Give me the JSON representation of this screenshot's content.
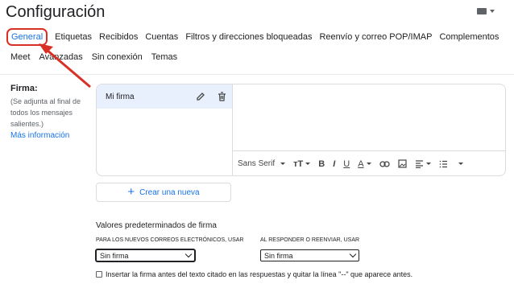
{
  "header": {
    "title": "Configuración",
    "keyboard_icon": "keyboard-icon"
  },
  "tabs_row1": [
    "General",
    "Etiquetas",
    "Recibidos",
    "Cuentas",
    "Filtros y direcciones bloqueadas",
    "Reenvío y correo POP/IMAP",
    "Complementos"
  ],
  "tabs_row2": [
    "Meet",
    "Avanzadas",
    "Sin conexión",
    "Temas"
  ],
  "signature": {
    "label": "Firma:",
    "note": "(Se adjunta al final de todos los mensajes salientes.)",
    "more_link": "Más información",
    "items": [
      "Mi firma"
    ],
    "font": "Sans Serif",
    "create_button": "Crear una nueva"
  },
  "defaults": {
    "title": "Valores predeterminados de firma",
    "new_label": "PARA LOS NUEVOS CORREOS ELECTRÓNICOS, USAR",
    "new_value": "Sin firma",
    "reply_label": "AL RESPONDER O REENVIAR, USAR",
    "reply_value": "Sin firma"
  },
  "insert_option": "Insertar la firma antes del texto citado en las respuestas y quitar la línea \"--\" que aparece antes.",
  "colors": {
    "accent": "#1a73e8",
    "highlight": "#d93025",
    "selected_bg": "#e8f0fe"
  }
}
